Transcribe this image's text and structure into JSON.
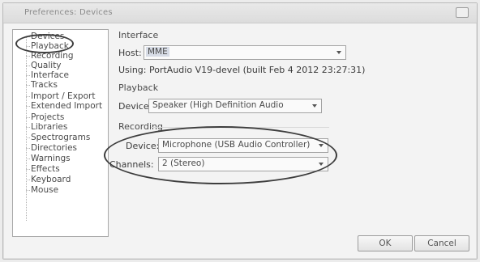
{
  "window": {
    "title": "Preferences: Devices"
  },
  "sidebar": {
    "items": [
      {
        "label": "Devices"
      },
      {
        "label": "Playback"
      },
      {
        "label": "Recording"
      },
      {
        "label": "Quality"
      },
      {
        "label": "Interface"
      },
      {
        "label": "Tracks"
      },
      {
        "label": "Import / Export"
      },
      {
        "label": "Extended Import"
      },
      {
        "label": "Projects"
      },
      {
        "label": "Libraries"
      },
      {
        "label": "Spectrograms"
      },
      {
        "label": "Directories"
      },
      {
        "label": "Warnings"
      },
      {
        "label": "Effects"
      },
      {
        "label": "Keyboard"
      },
      {
        "label": "Mouse"
      }
    ]
  },
  "interface": {
    "section_title": "Interface",
    "host_label": "Host:",
    "host_value": "MME",
    "using_text": "Using: PortAudio V19-devel (built Feb  4 2012 23:27:31)"
  },
  "playback": {
    "section_title": "Playback",
    "device_label": "Device:",
    "device_value": "Speaker (High Definition Audio"
  },
  "recording": {
    "section_title": "Recording",
    "device_label": "Device:",
    "device_value": "Microphone (USB Audio Controller)",
    "channels_label": "Channels:",
    "channels_value": "2 (Stereo)"
  },
  "buttons": {
    "ok": "OK",
    "cancel": "Cancel"
  }
}
